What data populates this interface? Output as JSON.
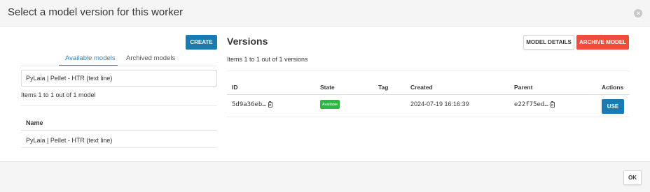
{
  "modal": {
    "title": "Select a model version for this worker"
  },
  "left": {
    "create_label": "CREATE",
    "tabs": [
      {
        "label": "Available models",
        "active": true
      },
      {
        "label": "Archived models",
        "active": false
      }
    ],
    "search_value": "PyLaia | Pellet - HTR (text line)",
    "count_text": "Items 1 to 1 out of 1 model",
    "table": {
      "columns": [
        "Name"
      ],
      "rows": [
        [
          "PyLaia | Pellet - HTR (text line)"
        ]
      ]
    }
  },
  "right": {
    "title": "Versions",
    "model_details_label": "MODEL DETAILS",
    "archive_model_label": "ARCHIVE MODEL",
    "count_text": "Items 1 to 1 out of 1 versions",
    "table": {
      "columns": [
        "ID",
        "State",
        "Tag",
        "Created",
        "Parent",
        "Actions"
      ],
      "rows": [
        {
          "id": "5d9a36eb…",
          "state": "Available",
          "tag": "",
          "created": "2024-07-19 16:16:39",
          "parent": "e22f75ed…",
          "action_label": "USE"
        }
      ]
    }
  },
  "footer": {
    "ok_label": "OK"
  },
  "colors": {
    "primary": "#1b7bb0",
    "danger": "#f04b3b",
    "success": "#2ab845",
    "tab_active": "#2a85c2"
  },
  "icons": [
    "close-icon",
    "clipboard-icon"
  ]
}
